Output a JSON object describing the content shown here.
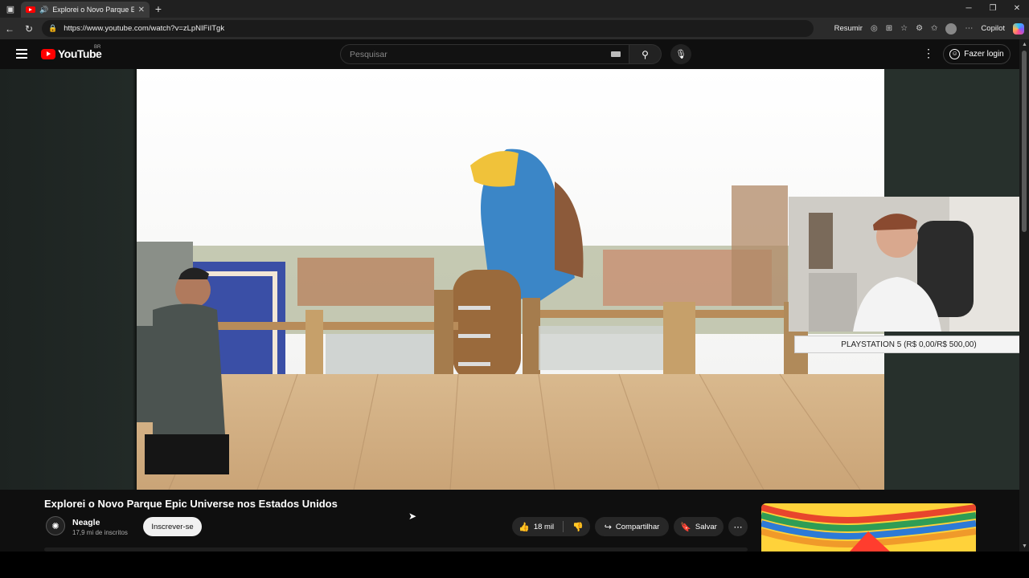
{
  "browser": {
    "tab_title": "Explorei o Novo Parque Epic",
    "url": "https://www.youtube.com/watch?v=zLpNIFiITgk",
    "summarize_label": "Resumir",
    "copilot_label": "Copilot"
  },
  "youtube": {
    "logo_text": "YouTube",
    "country_code": "BR",
    "search_placeholder": "Pesquisar",
    "login_label": "Fazer login"
  },
  "overlay": {
    "badge_text": "PLAYSTATION 5 (R$ 0,00/R$ 500,00)"
  },
  "video": {
    "title": "Explorei o Novo Parque Epic Universe nos Estados Unidos",
    "channel_name": "Neagle",
    "subscribers": "17,9 mi de inscritos",
    "subscribe_label": "Inscrever-se",
    "likes": "18 mil",
    "share_label": "Compartilhar",
    "save_label": "Salvar"
  },
  "colors": {
    "yt_red": "#ff0000",
    "page_bg": "#0f0f0f",
    "pill_bg": "#272727"
  }
}
